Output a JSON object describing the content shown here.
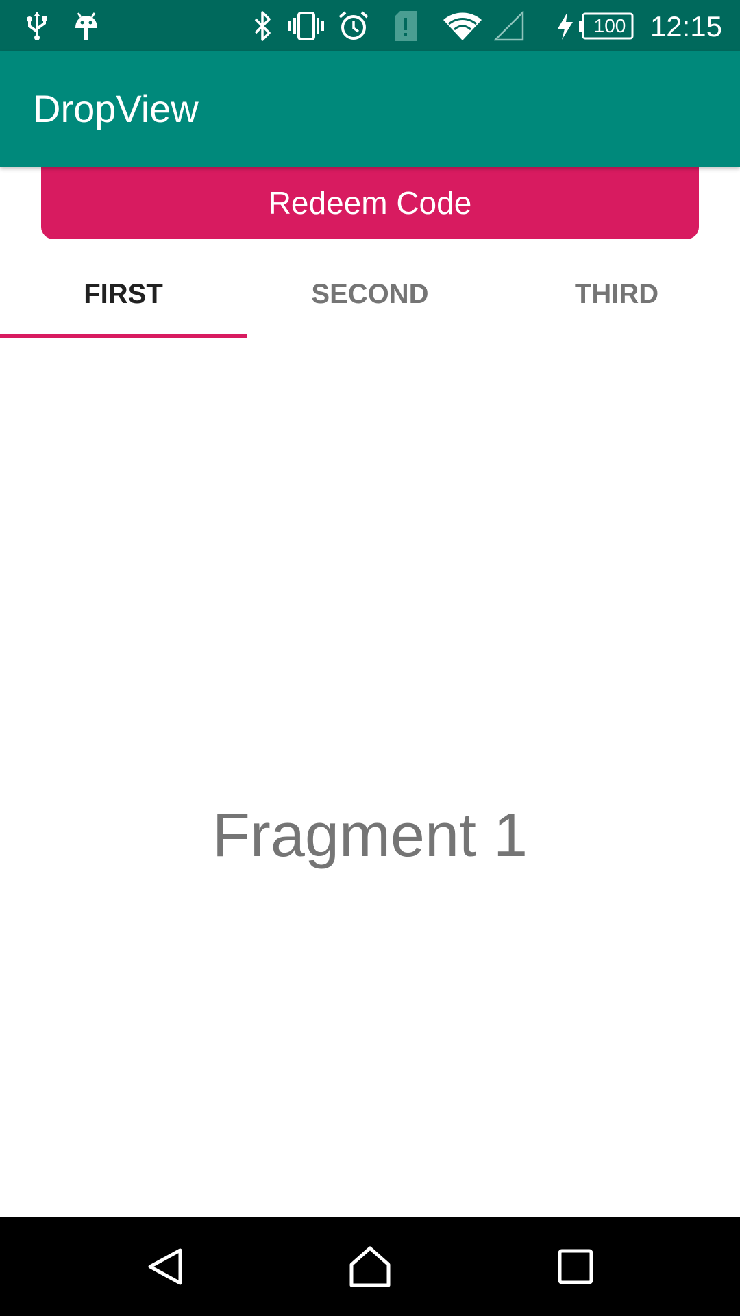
{
  "status_bar": {
    "time": "12:15",
    "battery_level": "100",
    "icons": [
      "usb-icon",
      "android-debug-icon",
      "bluetooth-icon",
      "vibrate-icon",
      "alarm-icon",
      "sim-alert-icon",
      "wifi-icon",
      "cell-signal-icon",
      "charging-icon",
      "battery-icon"
    ]
  },
  "app_bar": {
    "title": "DropView"
  },
  "redeem": {
    "label": "Redeem Code"
  },
  "tabs": [
    {
      "label": "FIRST",
      "selected": true
    },
    {
      "label": "SECOND",
      "selected": false
    },
    {
      "label": "THIRD",
      "selected": false
    }
  ],
  "content": {
    "text": "Fragment 1"
  },
  "nav_bar": {
    "buttons": [
      "back-icon",
      "home-icon",
      "recents-icon"
    ]
  },
  "colors": {
    "status_bar": "#00695c",
    "app_bar": "#00897b",
    "accent": "#d81b60",
    "tab_active": "#212121",
    "tab_inactive": "#757575"
  }
}
